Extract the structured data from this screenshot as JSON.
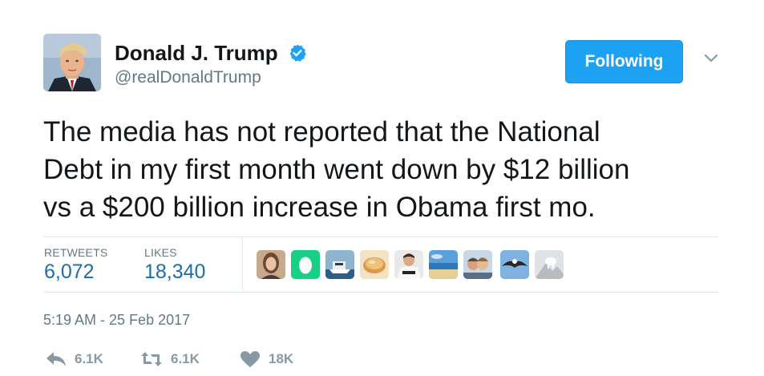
{
  "author": {
    "name": "Donald J. Trump",
    "handle": "@realDonaldTrump",
    "verified": true,
    "avatar": "profile-photo"
  },
  "follow_button": {
    "label": "Following",
    "color": "#1da1f2"
  },
  "tweet": {
    "lines": [
      "The media has not reported that the National",
      "Debt in my first month went down by $12 billion",
      "vs a $200 billion increase in Obama first mo."
    ]
  },
  "stats": {
    "retweets_label": "RETWEETS",
    "retweets_value": "6,072",
    "likes_label": "LIKES",
    "likes_value": "18,340"
  },
  "likers": [
    "woman-portrait-avatar",
    "default-egg-avatar",
    "boat-avatar",
    "food-avatar",
    "man-shirt-avatar",
    "beach-avatar",
    "couple-avatar",
    "eagle-avatar",
    "mountain-goat-avatar"
  ],
  "timestamp": "5:19 AM - 25 Feb 2017",
  "actions": {
    "reply": {
      "icon": "reply-icon",
      "count": "6.1K"
    },
    "retweet": {
      "icon": "retweet-icon",
      "count": "6.1K"
    },
    "like": {
      "icon": "heart-icon",
      "count": "18K"
    }
  },
  "colors": {
    "accent": "#1da1f2",
    "link": "#1b6ea8",
    "muted": "#657786",
    "action": "#8899a6",
    "divider": "#e1e8ed"
  }
}
